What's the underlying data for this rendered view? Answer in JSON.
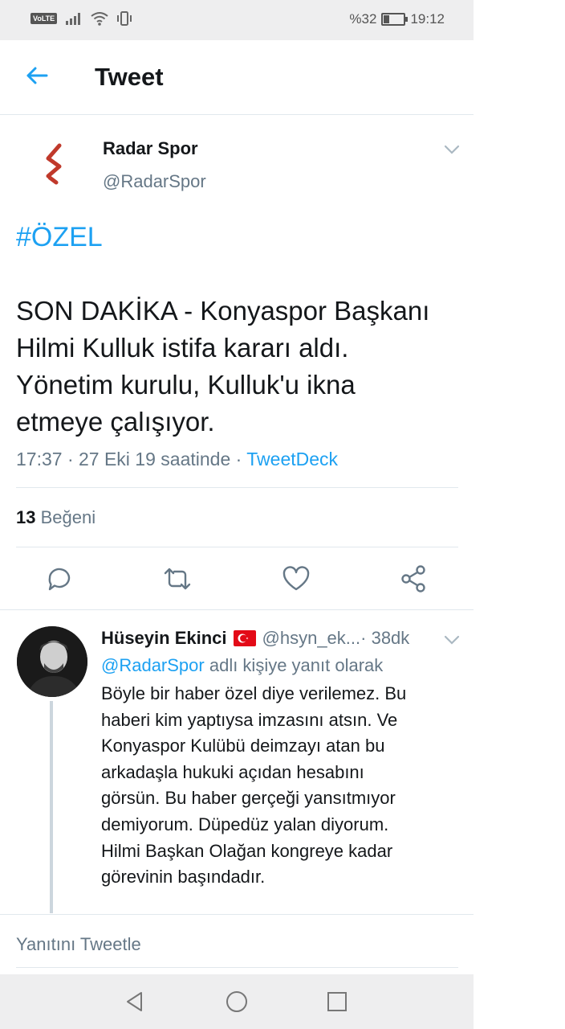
{
  "status_bar": {
    "network": "VoLTE",
    "battery": "%32",
    "battery_level": 0.32,
    "time": "19:12"
  },
  "header": {
    "title": "Tweet"
  },
  "tweet": {
    "author_name": "Radar Spor",
    "author_handle": "@RadarSpor",
    "hashtag": "#ÖZEL",
    "text": "SON DAKİKA - Konyaspor Başkanı\nHilmi Kulluk istifa kararı aldı.\nYönetim kurulu, Kulluk'u ikna\netmeye çalışıyor.",
    "timestamp": "17:37 · 27 Eki 19 saatinde · ",
    "source": "TweetDeck",
    "like_count": "13",
    "like_label": " Beğeni"
  },
  "reply": {
    "author_name": "Hüseyin Ekinci",
    "author_handle": "@hsyn_ek...",
    "time": " · 38dk",
    "reply_to_mention": "@RadarSpor",
    "reply_to_suffix": " adlı kişiye yanıt olarak",
    "text": "Böyle bir haber özel diye verilemez. Bu\nhaberi kim yaptıysa imzasını atsın. Ve\nKonyaspor Kulübü deimzayı atan bu\narkadaşla hukuki açıdan hesabını\ngörsün. Bu haber gerçeği yansıtmıyor\ndemiyorum. Düpedüz yalan diyorum.\nHilmi Başkan Olağan kongreye kadar\ngörevinin başındadır."
  },
  "compose": {
    "placeholder": "Yanıtını Tweetle"
  },
  "colors": {
    "accent": "#1da1f2",
    "secondary_text": "#657786",
    "brand_red": "#c0392b",
    "flag_red": "#e30a17"
  }
}
